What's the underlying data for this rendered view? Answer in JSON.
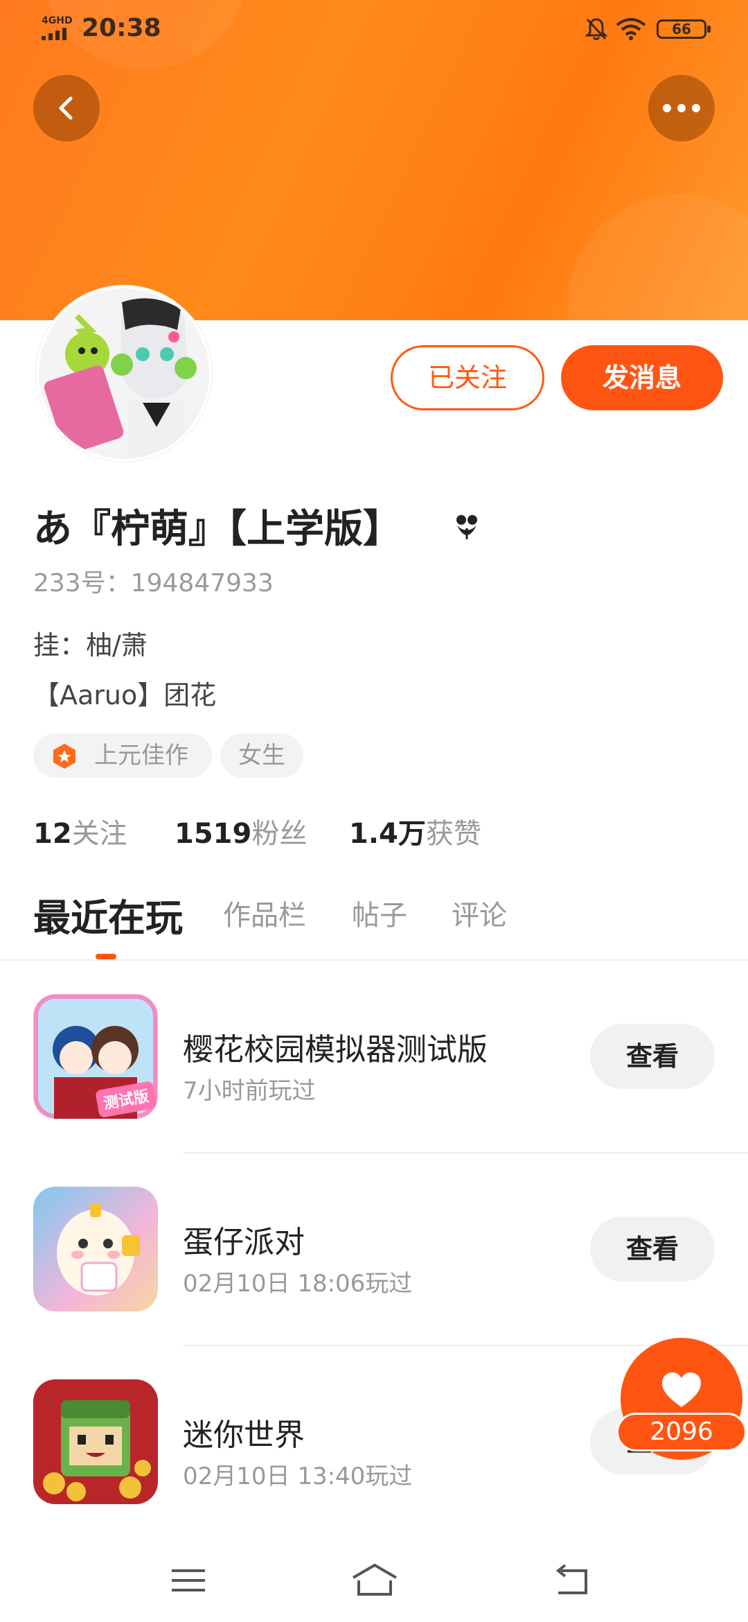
{
  "status_bar": {
    "network": "4GHD",
    "time": "20:38",
    "battery": "66"
  },
  "header": {
    "back_icon": "chevron-left-icon",
    "more_icon": "more-dots-icon"
  },
  "profile": {
    "follow_label": "已关注",
    "message_label": "发消息",
    "nickname": "あ『柠萌』【上学版】",
    "uid": "233号：194847933",
    "bio_line1": "挂：柚/萧",
    "bio_line2": "【Aaruo】团花",
    "tags": [
      "上元佳作",
      "女生"
    ],
    "stats": [
      {
        "value": "12",
        "label": "关注"
      },
      {
        "value": "1519",
        "label": "粉丝"
      },
      {
        "value": "1.4万",
        "label": "获赞"
      }
    ]
  },
  "tabs": [
    "最近在玩",
    "作品栏",
    "帖子",
    "评论"
  ],
  "games": [
    {
      "name": "樱花校园模拟器测试版",
      "time": "7小时前玩过",
      "button": "查看",
      "badge": "测试版"
    },
    {
      "name": "蛋仔派对",
      "time": "02月10日 18:06玩过",
      "button": "查看"
    },
    {
      "name": "迷你世界",
      "time": "02月10日 13:40玩过",
      "button": "查看"
    }
  ],
  "like_fab": {
    "count": "2096"
  },
  "colors": {
    "accent": "#ff5512",
    "header": "#ff7a1f",
    "muted": "#999999"
  }
}
